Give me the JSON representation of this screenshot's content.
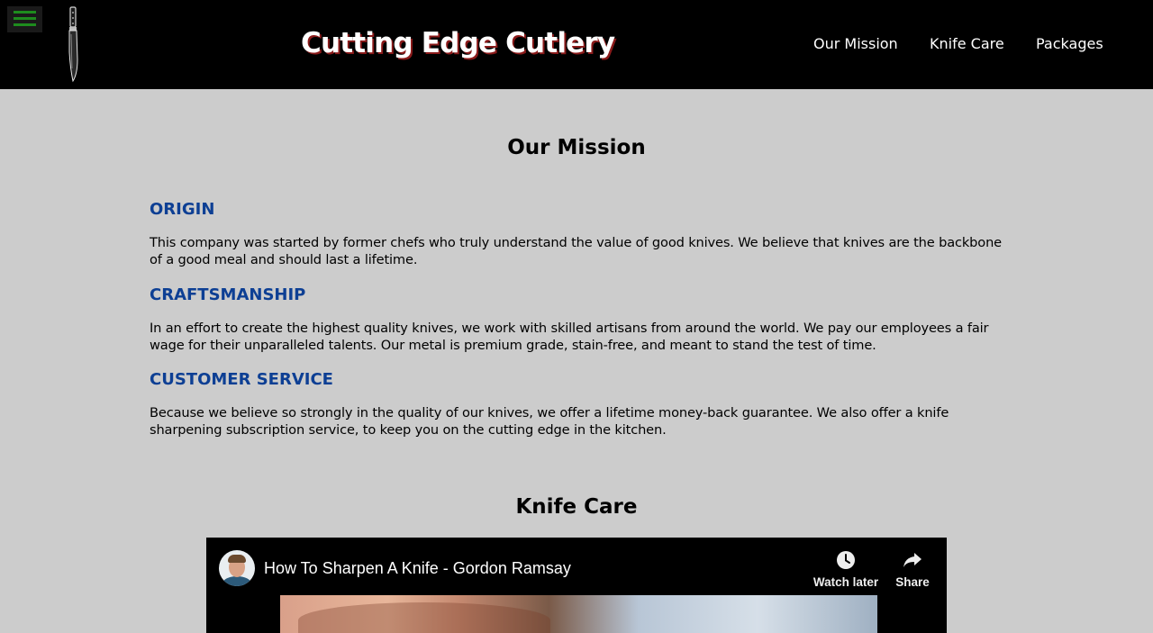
{
  "header": {
    "menu_icon": "hamburger-menu-icon",
    "logo_icon": "knife-icon",
    "site_title": "Cutting Edge Cutlery",
    "nav": [
      {
        "label": "Our Mission"
      },
      {
        "label": "Knife Care"
      },
      {
        "label": "Packages"
      }
    ],
    "colors": {
      "background": "#000000",
      "menu_bars": "#1e8c1e",
      "title_shadow": "#8a1a1a"
    }
  },
  "mission": {
    "title": "Our Mission",
    "sections": [
      {
        "heading": "ORIGIN",
        "text": "This company was started by former chefs who truly understand the value of good knives. We believe that knives are the backbone of a good meal and should last a lifetime."
      },
      {
        "heading": "CRAFTSMANSHIP",
        "text": "In an effort to create the highest quality knives, we work with skilled artisans from around the world. We pay our employees a fair wage for their unparalleled talents. Our metal is premium grade, stain-free, and meant to stand the test of time."
      },
      {
        "heading": "CUSTOMER SERVICE",
        "text": "Because we believe so strongly in the quality of our knives, we offer a lifetime money-back guarantee. We also offer a knife sharpening subscription service, to keep you on the cutting edge in the kitchen."
      }
    ],
    "colors": {
      "heading": "#0d3f94",
      "page_background": "#cccccc"
    }
  },
  "knife_care": {
    "title": "Knife Care",
    "video": {
      "title": "How To Sharpen A Knife - Gordon Ramsay",
      "watch_later_label": "Watch later",
      "watch_later_icon": "clock-icon",
      "share_label": "Share",
      "share_icon": "share-arrow-icon"
    }
  }
}
